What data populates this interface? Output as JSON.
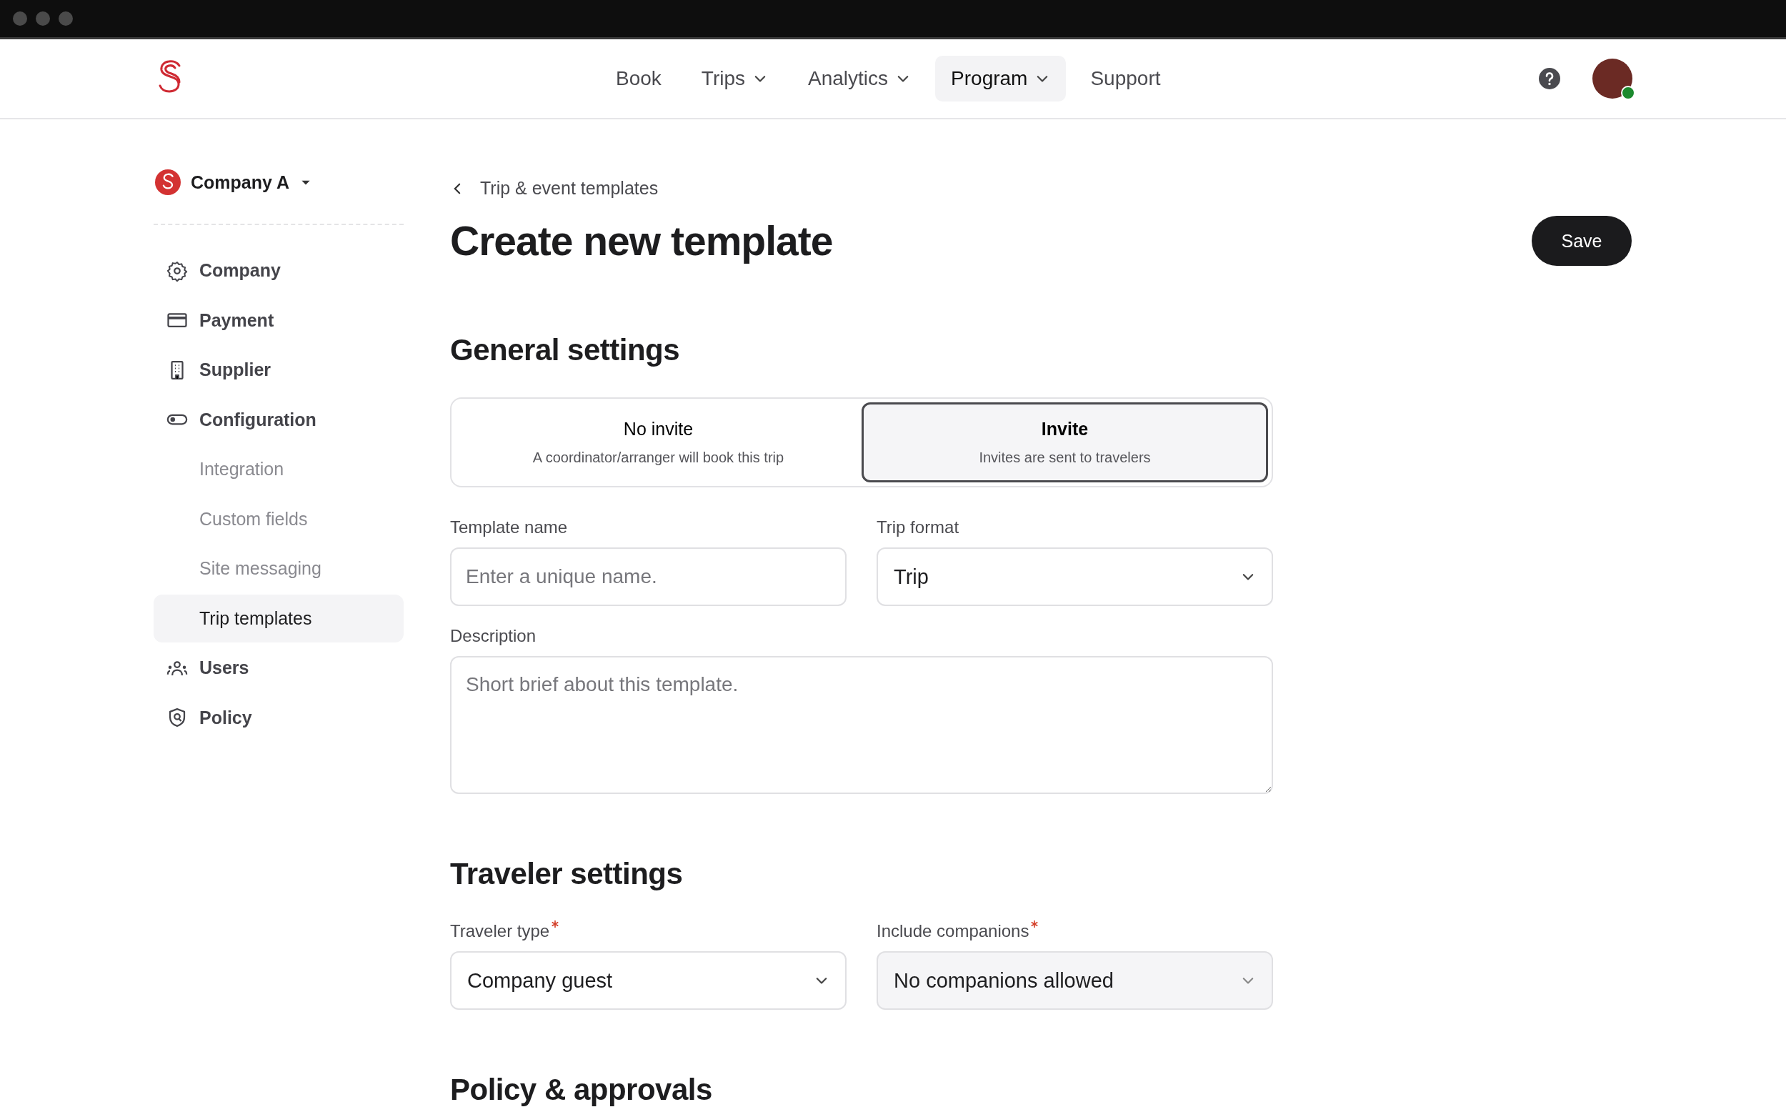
{
  "nav": {
    "items": [
      {
        "label": "Book",
        "dropdown": false,
        "selected": false
      },
      {
        "label": "Trips",
        "dropdown": true,
        "selected": false
      },
      {
        "label": "Analytics",
        "dropdown": true,
        "selected": false
      },
      {
        "label": "Program",
        "dropdown": true,
        "selected": true
      },
      {
        "label": "Support",
        "dropdown": false,
        "selected": false
      }
    ],
    "avatar": {
      "online": true
    }
  },
  "sidebar": {
    "company": "Company A",
    "items": [
      {
        "label": "Company",
        "kind": "main",
        "selected": false
      },
      {
        "label": "Payment",
        "kind": "main",
        "selected": false
      },
      {
        "label": "Supplier",
        "kind": "main",
        "selected": false
      },
      {
        "label": "Configuration",
        "kind": "main",
        "selected": false
      },
      {
        "label": "Integration",
        "kind": "sub",
        "selected": false
      },
      {
        "label": "Custom fields",
        "kind": "sub",
        "selected": false
      },
      {
        "label": "Site messaging",
        "kind": "sub",
        "selected": false
      },
      {
        "label": "Trip templates",
        "kind": "sub",
        "selected": true
      },
      {
        "label": "Users",
        "kind": "main",
        "selected": false
      },
      {
        "label": "Policy",
        "kind": "main",
        "selected": false
      }
    ]
  },
  "breadcrumb": "Trip & event templates",
  "title": "Create new template",
  "save_button": "Save",
  "sections": [
    {
      "title": "General settings",
      "invite_options": [
        {
          "title": "No invite",
          "subtitle": "A coordinator/arranger will book this trip",
          "selected": false
        },
        {
          "title": "Invite",
          "subtitle": "Invites are sent to travelers",
          "selected": true
        }
      ],
      "fields": [
        {
          "kind": "text",
          "label": "Template name",
          "placeholder": "Enter a unique name.",
          "required": false
        },
        {
          "kind": "select",
          "label": "Trip format",
          "value": "Trip",
          "required": false,
          "disabled": false
        },
        {
          "kind": "textarea",
          "label": "Description",
          "placeholder": "Short brief about this template.",
          "required": false
        }
      ]
    },
    {
      "title": "Traveler settings",
      "fields": [
        {
          "kind": "select",
          "label": "Traveler type",
          "value": "Company guest",
          "required": true,
          "disabled": false
        },
        {
          "kind": "select",
          "label": "Include companions",
          "value": "No companions allowed",
          "required": true,
          "disabled": true
        }
      ]
    },
    {
      "title": "Policy & approvals"
    }
  ]
}
